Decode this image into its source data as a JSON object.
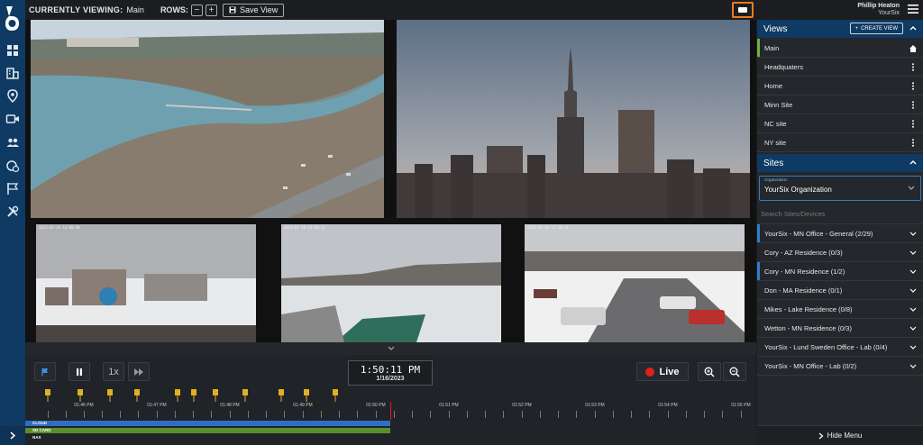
{
  "topbar": {
    "currently_viewing_label": "CURRENTLY VIEWING:",
    "current_view": "Main",
    "rows_label": "ROWS:",
    "minus": "−",
    "plus": "+",
    "save_view": "Save View"
  },
  "user": {
    "name": "Phillip Heaton",
    "org": "YourSix"
  },
  "cameras": [
    {
      "stamp": ""
    },
    {
      "stamp": ""
    },
    {
      "stamp": "2023-01-16 13:00:00"
    },
    {
      "stamp": "2023-01-16 13:50:11"
    },
    {
      "stamp": "2023-01-16 13:50:11"
    }
  ],
  "controls": {
    "speed": "1x",
    "time": "1:50:11 PM",
    "date": "1/16/2023",
    "live": "Live"
  },
  "timeline": {
    "ticks": [
      "01:46 PM",
      "01:47 PM",
      "01:48 PM",
      "01:49 PM",
      "01:50 PM",
      "01:51 PM",
      "01:52 PM",
      "01:53 PM",
      "01:54 PM",
      "01:55 PM"
    ],
    "tracks": [
      "CLOUD",
      "SD CARD",
      "NAS"
    ]
  },
  "views": {
    "title": "Views",
    "create_label": "CREATE VIEW",
    "items": [
      {
        "label": "Main"
      },
      {
        "label": "Headquaters"
      },
      {
        "label": "Home"
      },
      {
        "label": "Minn Site"
      },
      {
        "label": "NC site"
      },
      {
        "label": "NY site"
      }
    ]
  },
  "sites": {
    "title": "Sites",
    "org_label": "Organization",
    "org_value": "YourSix Organization",
    "search_placeholder": "Search Sites/Devices",
    "items": [
      {
        "label": "YourSix - MN Office - General (2/29)"
      },
      {
        "label": "Cory - AZ Residence (0/3)"
      },
      {
        "label": "Cory - MN Residence (1/2)"
      },
      {
        "label": "Don - MA Residence (0/1)"
      },
      {
        "label": "Mikes - Lake Residence (0/8)"
      },
      {
        "label": "Wetton - MN Residence (0/3)"
      },
      {
        "label": "YourSix - Lund Sweden Office - Lab (0/4)"
      },
      {
        "label": "YourSix - MN Office - Lab (0/2)"
      }
    ]
  },
  "hide_menu": "Hide Menu",
  "colors": {
    "accent_blue": "#0f3a63",
    "highlight_orange": "#f07b1d",
    "live_red": "#e0201b",
    "cloud_track": "#2f6fc0",
    "sd_track": "#5b8f2e"
  }
}
